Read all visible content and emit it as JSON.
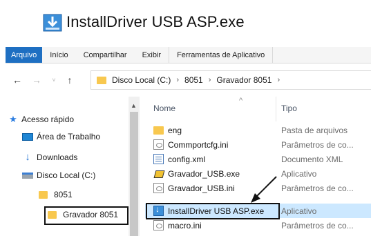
{
  "header": {
    "title": "InstallDriver USB ASP.exe",
    "icon": "install-download-icon"
  },
  "ribbon": {
    "tabs": [
      "Arquivo",
      "Início",
      "Compartilhar",
      "Exibir",
      "Ferramentas de Aplicativo"
    ],
    "file_tab_color": "#1e6fc2"
  },
  "address": {
    "path": [
      "Disco Local (C:)",
      "8051",
      "Gravador 8051"
    ],
    "separator": "›",
    "back": "←",
    "forward": "→",
    "recent": "˅",
    "up": "↑"
  },
  "nav": {
    "items": [
      {
        "label": "Acesso rápido",
        "icon": "star-icon"
      },
      {
        "label": "Área de Trabalho",
        "icon": "desktop-icon"
      },
      {
        "label": "Downloads",
        "icon": "download-arrow-icon"
      },
      {
        "label": "Disco Local (C:)",
        "icon": "drive-icon"
      },
      {
        "label": "8051",
        "icon": "folder-icon"
      },
      {
        "label": "Gravador 8051",
        "icon": "folder-icon"
      }
    ]
  },
  "list": {
    "columns": {
      "name": "Nome",
      "type": "Tipo"
    },
    "files": [
      {
        "name": "eng",
        "type": "Pasta de arquivos",
        "icon": "folder-icon"
      },
      {
        "name": "Commportcfg.ini",
        "type": "Parâmetros de co...",
        "icon": "ini-file-icon"
      },
      {
        "name": "config.xml",
        "type": "Documento XML",
        "icon": "xml-file-icon"
      },
      {
        "name": "Gravador_USB.exe",
        "type": "Aplicativo",
        "icon": "app-chip-icon"
      },
      {
        "name": "Gravador_USB.ini",
        "type": "Parâmetros de co...",
        "icon": "ini-file-icon"
      },
      {
        "name": "InstallDriver USB ASP.exe",
        "type": "Aplicativo",
        "icon": "install-download-icon",
        "selected": true
      },
      {
        "name": "macro.ini",
        "type": "Parâmetros de co...",
        "icon": "ini-file-icon"
      }
    ]
  },
  "colors": {
    "selection": "#cce8ff",
    "accent": "#1e6fc2",
    "folder": "#f8c84f"
  }
}
